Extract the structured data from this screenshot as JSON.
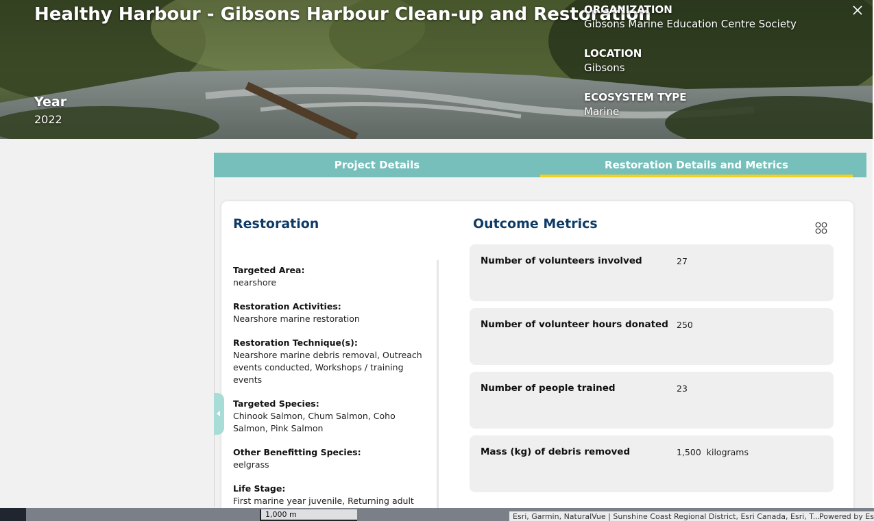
{
  "header": {
    "title": "Healthy Harbour - Gibsons Harbour Clean-up and Restoration",
    "year_label": "Year",
    "year_value": "2022",
    "fields": [
      {
        "label": "ORGANIZATION",
        "value": "Gibsons Marine Education Centre Society"
      },
      {
        "label": "LOCATION",
        "value": "Gibsons"
      },
      {
        "label": "ECOSYSTEM TYPE",
        "value": "Marine"
      }
    ],
    "close_icon": "close-icon"
  },
  "tabs": [
    {
      "label": "Project Details",
      "active": false
    },
    {
      "label": "Restoration Details and Metrics",
      "active": true
    }
  ],
  "colors": {
    "tab_bar": "#76bfba",
    "active_underline": "#f2d21e",
    "section_title": "#0e3b66"
  },
  "restoration": {
    "title": "Restoration",
    "items": [
      {
        "label": "Targeted Area:",
        "value": "nearshore"
      },
      {
        "label": "Restoration Activities:",
        "value": "Nearshore marine restoration"
      },
      {
        "label": "Restoration Technique(s):",
        "value": "Nearshore marine debris removal, Outreach events conducted, Workshops / training events"
      },
      {
        "label": "Targeted Species:",
        "value": "Chinook Salmon, Chum Salmon, Coho Salmon, Pink Salmon"
      },
      {
        "label": "Other Benefitting Species:",
        "value": "eelgrass"
      },
      {
        "label": "Life Stage:",
        "value": "First marine year juvenile, Returning adult"
      }
    ]
  },
  "outcome": {
    "title": "Outcome Metrics",
    "menu_icon": "grid-icon",
    "metrics": [
      {
        "label": "Number of volunteers involved",
        "value": "27"
      },
      {
        "label": "Number of volunteer hours donated",
        "value": "250"
      },
      {
        "label": "Number of people trained",
        "value": "23"
      },
      {
        "label": "Mass (kg) of debris removed",
        "value": "1,500  kilograms"
      }
    ]
  },
  "map": {
    "scale_label": "1,000 m",
    "attribution": "Esri, Garmin, NaturalVue | Sunshine Coast Regional District, Esri Canada, Esri, T...",
    "powered_by": "Powered by Es"
  }
}
